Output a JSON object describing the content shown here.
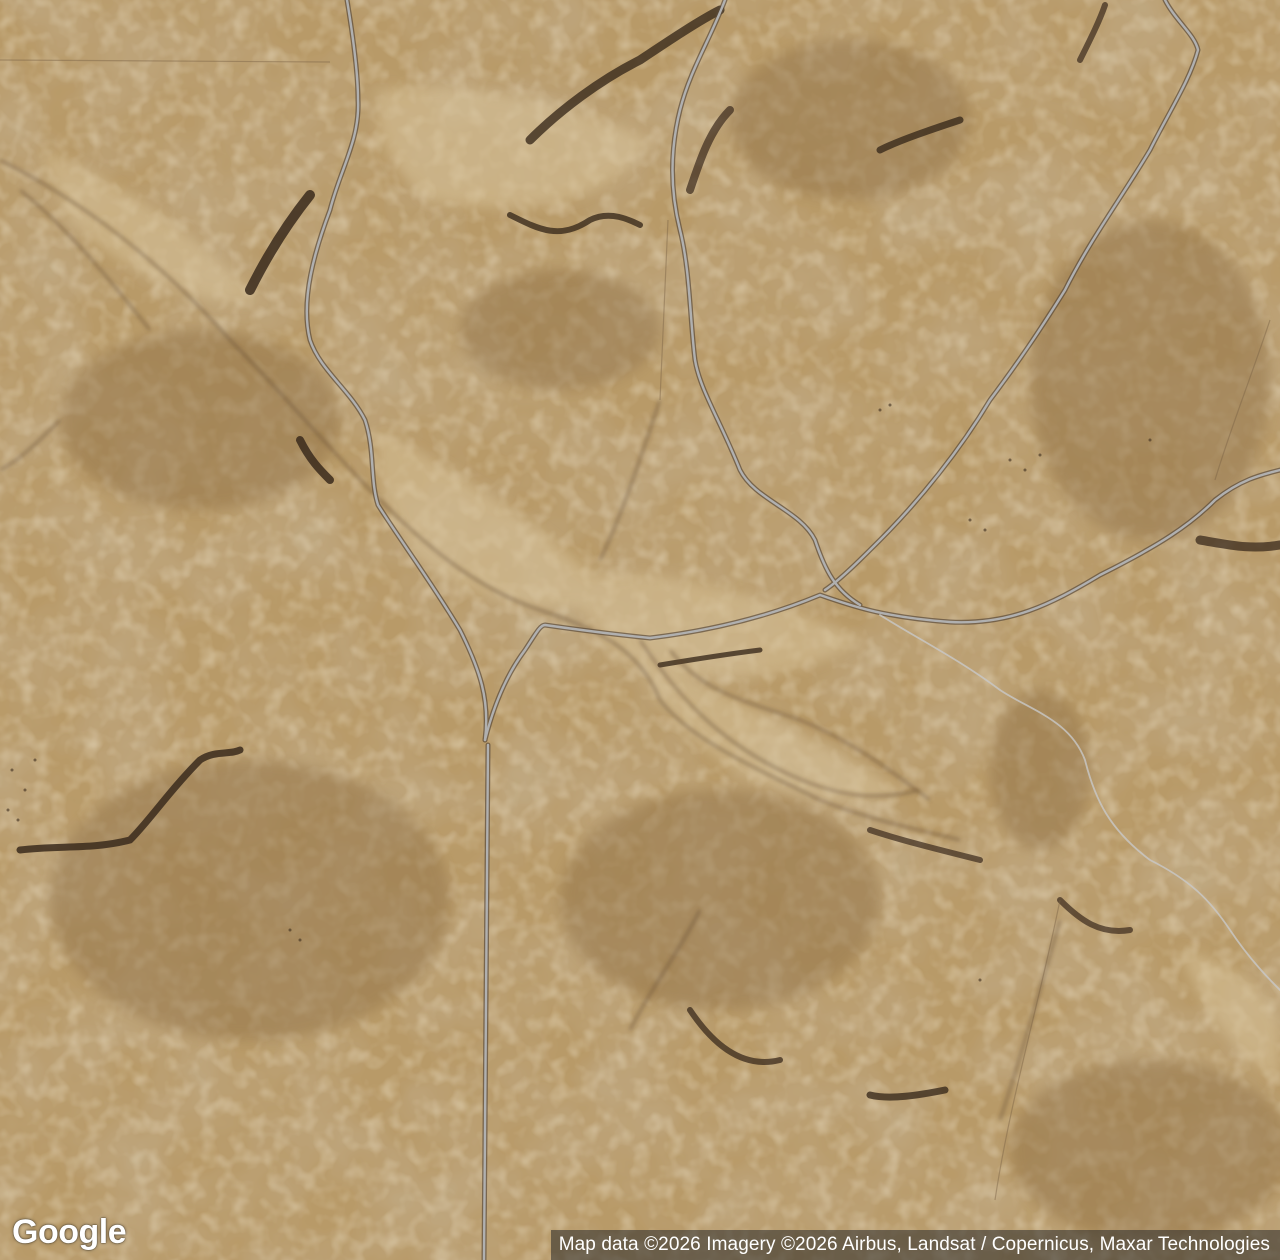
{
  "map": {
    "type": "satellite",
    "colors": {
      "terrain_base": "#b89a68",
      "terrain_light": "#d8c39a",
      "terrain_dark": "#8f6f44",
      "wash_dark": "#3a2a1c",
      "road": "#9a9a9a",
      "road_edge": "#5a4a3a"
    }
  },
  "branding": {
    "logo_text": "Google"
  },
  "attribution": {
    "text": "Map data ©2026 Imagery ©2026 Airbus, Landsat / Copernicus, Maxar Technologies"
  }
}
